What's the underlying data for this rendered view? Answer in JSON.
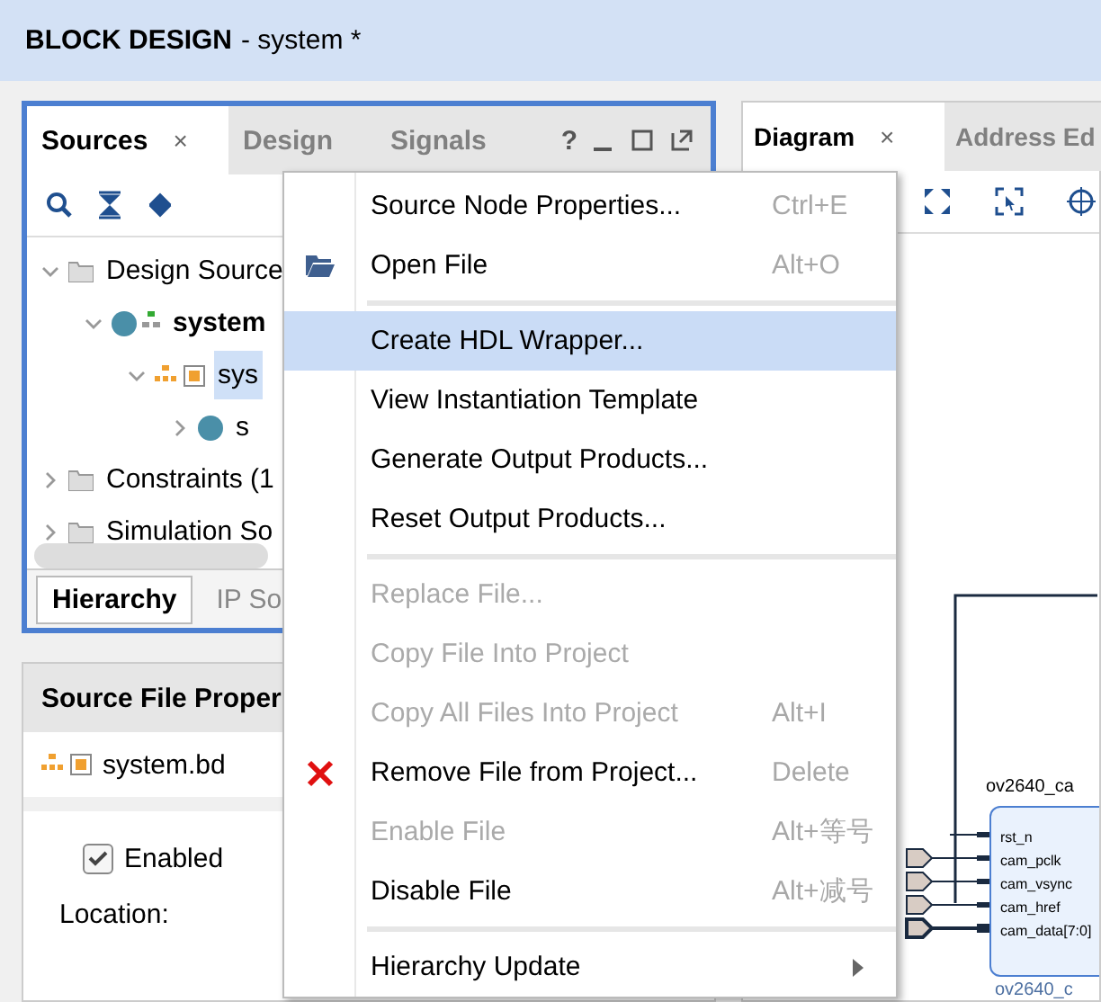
{
  "header": {
    "title": "BLOCK DESIGN",
    "subtitle": "- system *"
  },
  "sources": {
    "tabs": [
      {
        "label": "Sources",
        "selected": true,
        "close": "×"
      },
      {
        "label": "Design",
        "selected": false
      },
      {
        "label": "Signals",
        "selected": false
      }
    ],
    "help": "?",
    "tree": [
      {
        "label": "Design Source",
        "kind": "folder",
        "expanded": true,
        "selected": false,
        "top": false,
        "children": [
          {
            "label": "system",
            "kind": "design",
            "expanded": true,
            "selected": false,
            "top": true,
            "children": [
              {
                "label": "sys",
                "kind": "block",
                "expanded": true,
                "selected": true,
                "top": false,
                "children": [
                  {
                    "label": "s",
                    "kind": "ip",
                    "expanded": false,
                    "selected": false,
                    "top": false
                  }
                ]
              }
            ]
          }
        ]
      },
      {
        "label": "Constraints (1",
        "kind": "folder",
        "expanded": false,
        "selected": false,
        "top": false
      },
      {
        "label": "Simulation So",
        "kind": "folder",
        "expanded": false,
        "selected": false,
        "top": false
      }
    ],
    "bottom_tabs": [
      {
        "label": "Hierarchy",
        "selected": true
      },
      {
        "label": "IP So",
        "selected": false
      }
    ]
  },
  "properties": {
    "title": "Source File Proper",
    "file": "system.bd",
    "enabled": {
      "label": "Enabled",
      "checked": true
    },
    "location": {
      "label": "Location:"
    }
  },
  "diagram": {
    "tabs": [
      {
        "label": "Diagram",
        "selected": true,
        "close": "×"
      },
      {
        "label": "Address Ed",
        "selected": false
      }
    ],
    "block": {
      "title": "ov2640_ca",
      "name": "ov2640_c",
      "ports": [
        {
          "name": "rst_n",
          "kind": "wire",
          "external": false
        },
        {
          "name": "cam_pclk",
          "kind": "wire",
          "external": true
        },
        {
          "name": "cam_vsync",
          "kind": "wire",
          "external": true
        },
        {
          "name": "cam_href",
          "kind": "wire",
          "external": true
        },
        {
          "name": "cam_data[7:0]",
          "kind": "bus",
          "external": true
        }
      ]
    }
  },
  "menu": [
    {
      "kind": "item",
      "label": "Source Node Properties...",
      "shortcut": "Ctrl+E",
      "disabled": false,
      "selected": false
    },
    {
      "kind": "open",
      "label": "Open File",
      "shortcut": "Alt+O",
      "disabled": false,
      "selected": false
    },
    {
      "kind": "separator"
    },
    {
      "kind": "item",
      "label": "Create HDL Wrapper...",
      "disabled": false,
      "selected": true
    },
    {
      "kind": "item",
      "label": "View Instantiation Template",
      "disabled": false,
      "selected": false
    },
    {
      "kind": "item",
      "label": "Generate Output Products...",
      "disabled": false,
      "selected": false
    },
    {
      "kind": "item",
      "label": "Reset Output Products...",
      "disabled": false,
      "selected": false
    },
    {
      "kind": "separator"
    },
    {
      "kind": "item",
      "label": "Replace File...",
      "disabled": true,
      "selected": false
    },
    {
      "kind": "item",
      "label": "Copy File Into Project",
      "disabled": true,
      "selected": false
    },
    {
      "kind": "item",
      "label": "Copy All Files Into Project",
      "shortcut": "Alt+I",
      "disabled": true,
      "selected": false
    },
    {
      "kind": "remove",
      "label": "Remove File from Project...",
      "shortcut": "Delete",
      "disabled": false,
      "selected": false
    },
    {
      "kind": "item",
      "label": "Enable File",
      "shortcut": "Alt+等号",
      "disabled": true,
      "selected": false
    },
    {
      "kind": "item",
      "label": "Disable File",
      "shortcut": "Alt+减号",
      "disabled": false,
      "selected": false
    },
    {
      "kind": "separator"
    },
    {
      "kind": "item",
      "label": "Hierarchy Update",
      "submenu": true,
      "disabled": false,
      "selected": false
    }
  ]
}
